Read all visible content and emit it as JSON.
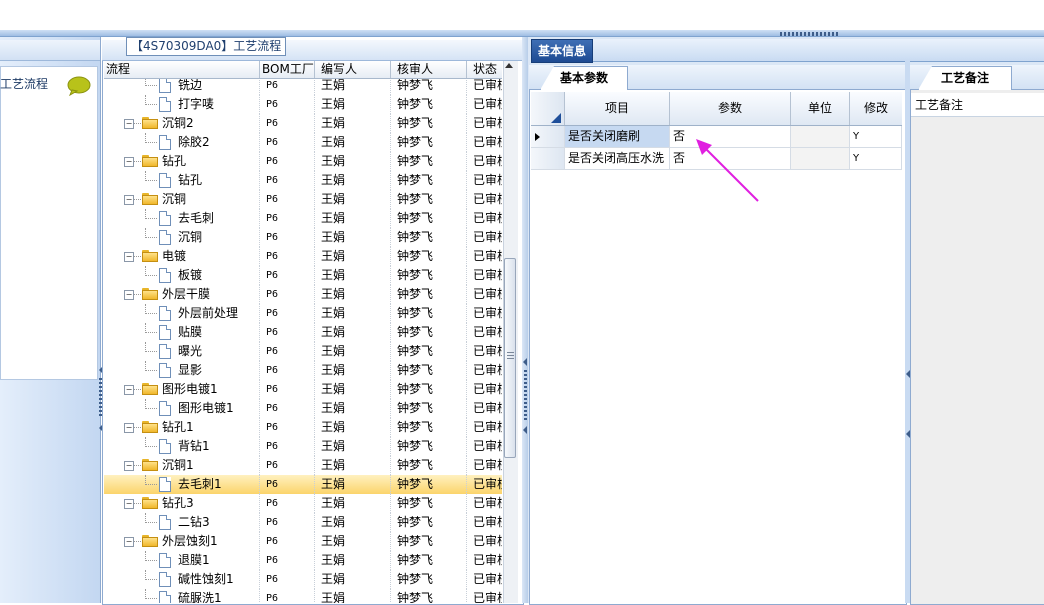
{
  "left_panel": {
    "item_label": "工艺流程"
  },
  "flow_panel": {
    "title": "【4S70309DA0】工艺流程",
    "columns": [
      "流程",
      "BOM工厂",
      "编写人",
      "核审人",
      "状态"
    ],
    "rows": [
      {
        "name": "铣边",
        "level": 1,
        "type": "doc",
        "bom": "P6",
        "writer": "王娟",
        "reviewer": "钟梦飞",
        "status": "已审核"
      },
      {
        "name": "打字唛",
        "level": 1,
        "type": "doc",
        "bom": "P6",
        "writer": "王娟",
        "reviewer": "钟梦飞",
        "status": "已审核"
      },
      {
        "name": "沉铜2",
        "level": 0,
        "type": "folder",
        "bom": "P6",
        "writer": "王娟",
        "reviewer": "钟梦飞",
        "status": "已审核"
      },
      {
        "name": "除胶2",
        "level": 1,
        "type": "doc",
        "bom": "P6",
        "writer": "王娟",
        "reviewer": "钟梦飞",
        "status": "已审核"
      },
      {
        "name": "钻孔",
        "level": 0,
        "type": "folder",
        "bom": "P6",
        "writer": "王娟",
        "reviewer": "钟梦飞",
        "status": "已审核"
      },
      {
        "name": "钻孔",
        "level": 1,
        "type": "doc",
        "bom": "P6",
        "writer": "王娟",
        "reviewer": "钟梦飞",
        "status": "已审核"
      },
      {
        "name": "沉铜",
        "level": 0,
        "type": "folder",
        "bom": "P6",
        "writer": "王娟",
        "reviewer": "钟梦飞",
        "status": "已审核"
      },
      {
        "name": "去毛刺",
        "level": 1,
        "type": "doc",
        "bom": "P6",
        "writer": "王娟",
        "reviewer": "钟梦飞",
        "status": "已审核"
      },
      {
        "name": "沉铜",
        "level": 1,
        "type": "doc",
        "bom": "P6",
        "writer": "王娟",
        "reviewer": "钟梦飞",
        "status": "已审核"
      },
      {
        "name": "电镀",
        "level": 0,
        "type": "folder",
        "bom": "P6",
        "writer": "王娟",
        "reviewer": "钟梦飞",
        "status": "已审核"
      },
      {
        "name": "板镀",
        "level": 1,
        "type": "doc",
        "bom": "P6",
        "writer": "王娟",
        "reviewer": "钟梦飞",
        "status": "已审核"
      },
      {
        "name": "外层干膜",
        "level": 0,
        "type": "folder",
        "bom": "P6",
        "writer": "王娟",
        "reviewer": "钟梦飞",
        "status": "已审核"
      },
      {
        "name": "外层前处理",
        "level": 1,
        "type": "doc",
        "bom": "P6",
        "writer": "王娟",
        "reviewer": "钟梦飞",
        "status": "已审核"
      },
      {
        "name": "贴膜",
        "level": 1,
        "type": "doc",
        "bom": "P6",
        "writer": "王娟",
        "reviewer": "钟梦飞",
        "status": "已审核"
      },
      {
        "name": "曝光",
        "level": 1,
        "type": "doc",
        "bom": "P6",
        "writer": "王娟",
        "reviewer": "钟梦飞",
        "status": "已审核"
      },
      {
        "name": "显影",
        "level": 1,
        "type": "doc",
        "bom": "P6",
        "writer": "王娟",
        "reviewer": "钟梦飞",
        "status": "已审核"
      },
      {
        "name": "图形电镀1",
        "level": 0,
        "type": "folder",
        "bom": "P6",
        "writer": "王娟",
        "reviewer": "钟梦飞",
        "status": "已审核"
      },
      {
        "name": "图形电镀1",
        "level": 1,
        "type": "doc",
        "bom": "P6",
        "writer": "王娟",
        "reviewer": "钟梦飞",
        "status": "已审核"
      },
      {
        "name": "钻孔1",
        "level": 0,
        "type": "folder",
        "bom": "P6",
        "writer": "王娟",
        "reviewer": "钟梦飞",
        "status": "已审核"
      },
      {
        "name": "背钻1",
        "level": 1,
        "type": "doc",
        "bom": "P6",
        "writer": "王娟",
        "reviewer": "钟梦飞",
        "status": "已审核"
      },
      {
        "name": "沉铜1",
        "level": 0,
        "type": "folder",
        "bom": "P6",
        "writer": "王娟",
        "reviewer": "钟梦飞",
        "status": "已审核"
      },
      {
        "name": "去毛刺1",
        "level": 1,
        "type": "doc",
        "selected": true,
        "bom": "P6",
        "writer": "王娟",
        "reviewer": "钟梦飞",
        "status": "已审核"
      },
      {
        "name": "钻孔3",
        "level": 0,
        "type": "folder",
        "bom": "P6",
        "writer": "王娟",
        "reviewer": "钟梦飞",
        "status": "已审核"
      },
      {
        "name": "二钻3",
        "level": 1,
        "type": "doc",
        "bom": "P6",
        "writer": "王娟",
        "reviewer": "钟梦飞",
        "status": "已审核"
      },
      {
        "name": "外层蚀刻1",
        "level": 0,
        "type": "folder",
        "bom": "P6",
        "writer": "王娟",
        "reviewer": "钟梦飞",
        "status": "已审核"
      },
      {
        "name": "退膜1",
        "level": 1,
        "type": "doc",
        "bom": "P6",
        "writer": "王娟",
        "reviewer": "钟梦飞",
        "status": "已审核"
      },
      {
        "name": "碱性蚀刻1",
        "level": 1,
        "type": "doc",
        "bom": "P6",
        "writer": "王娟",
        "reviewer": "钟梦飞",
        "status": "已审核"
      },
      {
        "name": "硫脲洗1",
        "level": 1,
        "type": "doc",
        "bom": "P6",
        "writer": "王娟",
        "reviewer": "钟梦飞",
        "status": "已审核"
      }
    ]
  },
  "right": {
    "basic_info_tab": "基本信息",
    "params_tab": "基本参数",
    "notes_tab": "工艺备注",
    "notes_header": "工艺备注",
    "params_columns": [
      "项目",
      "参数",
      "单位",
      "修改"
    ],
    "params_rows": [
      {
        "item": "是否关闭磨刷",
        "value": "否",
        "unit": "",
        "modify": "Y"
      },
      {
        "item": "是否关闭高压水洗",
        "value": "否",
        "unit": "",
        "modify": "Y"
      }
    ]
  },
  "annotation": {
    "arrow_color": "#e020e0"
  }
}
